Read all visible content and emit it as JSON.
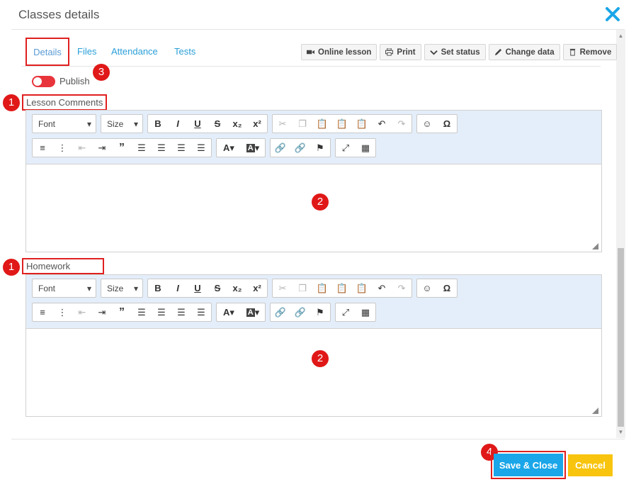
{
  "dialog": {
    "title": "Classes details"
  },
  "tabs": [
    {
      "label": "Details"
    },
    {
      "label": "Files"
    },
    {
      "label": "Attendance"
    },
    {
      "label": "Tests"
    }
  ],
  "actions": [
    {
      "label": "Online lesson",
      "icon": "video-camera-icon"
    },
    {
      "label": "Print",
      "icon": "printer-icon"
    },
    {
      "label": "Set status",
      "icon": "chevron-down-icon"
    },
    {
      "label": "Change data",
      "icon": "pencil-icon"
    },
    {
      "label": "Remove",
      "icon": "trash-icon"
    }
  ],
  "publish": {
    "label": "Publish",
    "enabled": false
  },
  "fields": {
    "lesson_comments": "Lesson Comments",
    "homework": "Homework"
  },
  "toolbar": {
    "font_combo": "Font",
    "size_combo": "Size"
  },
  "badges": {
    "one": "1",
    "two": "2",
    "three": "3",
    "four": "4"
  },
  "footer": {
    "save_label": "Save & Close",
    "cancel_label": "Cancel"
  },
  "colors": {
    "accent": "#1aa6e8",
    "cancel": "#f8c40e",
    "toggle_off": "#e8343b",
    "highlight": "#e02020",
    "toolbar_bg": "#e4eefa"
  }
}
